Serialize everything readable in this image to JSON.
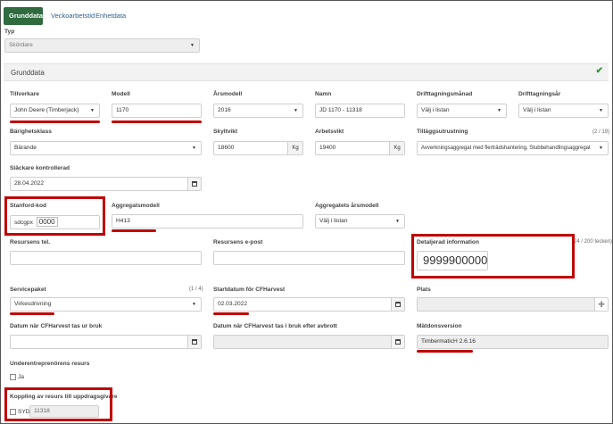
{
  "tabs": [
    {
      "label": "Grunddata",
      "active": true
    },
    {
      "label": "Veckoarbetstid",
      "active": false
    },
    {
      "label": "Enhetdata",
      "active": false
    }
  ],
  "typ": {
    "label": "Typ",
    "value": "Skördare"
  },
  "section": {
    "title": "Grunddata"
  },
  "fields": {
    "tillverkare": {
      "label": "Tillverkare",
      "value": "John Deere (Timberjack)"
    },
    "modell": {
      "label": "Modell",
      "value": "1170"
    },
    "arsmodell": {
      "label": "Årsmodell",
      "value": "2016"
    },
    "namn": {
      "label": "Namn",
      "value": "JD 1170 - 11318"
    },
    "drifttagningsmanad": {
      "label": "Drifttagningsmånad",
      "value": "Välj i listan"
    },
    "drifttagningsar": {
      "label": "Drifttagningsår",
      "value": "Välj i listan"
    },
    "barighetsklass": {
      "label": "Bärighetsklass",
      "value": "Bärande"
    },
    "skyltvikt": {
      "label": "Skyltvikt",
      "value": "18600",
      "unit": "Kg"
    },
    "arbetsvikt": {
      "label": "Arbetsvikt",
      "value": "19400",
      "unit": "Kg"
    },
    "tillaggsutrustning": {
      "label": "Tilläggsutrustning",
      "count": "(2 / 19)",
      "value": "Avverkningsaggregat med flerträdshantering, Stubbehandlingsaggregat"
    },
    "slackare": {
      "label": "Släckare kontrollerad",
      "value": "28.04.2022"
    },
    "stanford": {
      "label": "Stanford-kod",
      "prefix": "sdcgpx",
      "value": "0000"
    },
    "aggregatsmodell": {
      "label": "Aggregatsmodell",
      "value": "H413"
    },
    "aggregatets_arsmodell": {
      "label": "Aggregatets årsmodell",
      "value": "Välj i listan"
    },
    "resursens_tel": {
      "label": "Resursens tel.",
      "value": ""
    },
    "resursens_epost": {
      "label": "Resursens e-post",
      "value": ""
    },
    "detaljerad": {
      "label": "Detaljerad information",
      "count": "(24 / 200 tecken)",
      "value": "9999900000"
    },
    "servicepaket": {
      "label": "Servicepaket",
      "count": "(1 / 4)",
      "value": "Virkesdrivning"
    },
    "startdatum": {
      "label": "Startdatum för CFHarvest",
      "value": "02.03.2022"
    },
    "plats": {
      "label": "Plats",
      "value": ""
    },
    "datum_ur_bruk": {
      "label": "Datum när CFHarvest tas ur bruk",
      "value": ""
    },
    "datum_efter_avbrott": {
      "label": "Datum när CFHarvest tas i bruk efter avbrott",
      "value": ""
    },
    "matdonsversion": {
      "label": "Mätdonsversion",
      "value": "TimbermaticH 2.6.16"
    },
    "underentreprenor": {
      "label": "Underentreprenörens resurs",
      "option": "Ja"
    },
    "koppling": {
      "label": "Koppling av resurs till uppdragsgivare",
      "option": "SYD",
      "value": "11318"
    }
  },
  "colors": {
    "accent": "#2f6b3e",
    "highlight": "#c00000",
    "check": "#3a8f3a"
  }
}
